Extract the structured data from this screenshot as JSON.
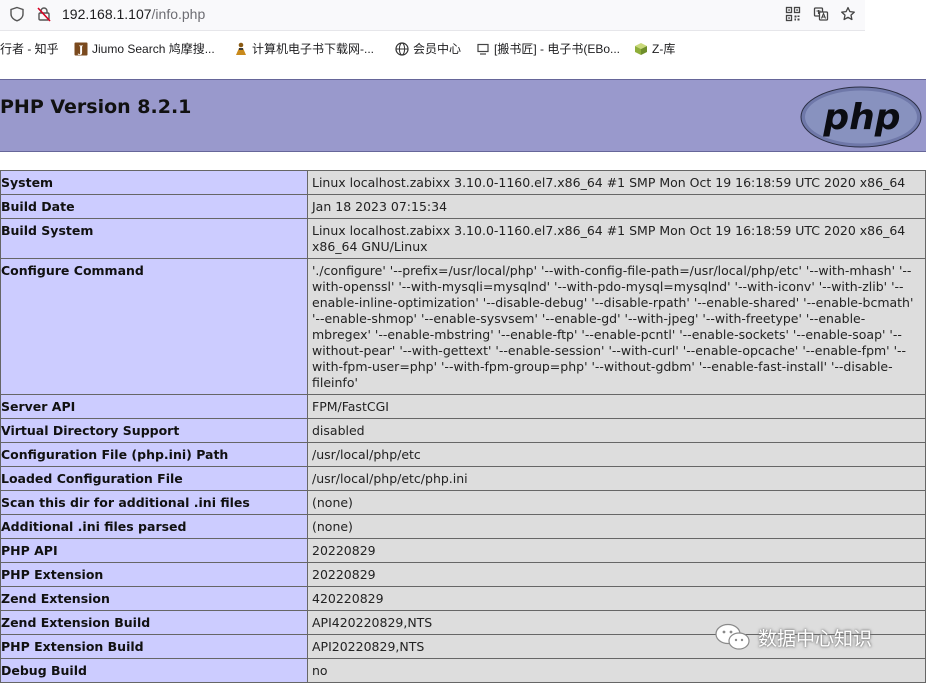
{
  "browser": {
    "url_host": "192.168.1.107",
    "url_path": "/info.php",
    "icons": [
      "shield-icon",
      "insecure-lock-icon",
      "qr-code-icon",
      "translate-icon",
      "star-icon"
    ]
  },
  "bookmarks": [
    {
      "label": "行者 - 知乎",
      "icon": "none"
    },
    {
      "label": "Jiumo Search 鸠摩搜...",
      "icon": "j-icon"
    },
    {
      "label": "计算机电子书下载网-...",
      "icon": "figure-icon"
    },
    {
      "label": "会员中心",
      "icon": "globe-icon"
    },
    {
      "label": "[搬书匠] - 电子书(EBo...",
      "icon": "monitor-icon"
    },
    {
      "label": "Z-库",
      "icon": "cube-icon"
    }
  ],
  "header": {
    "title": "PHP Version 8.2.1",
    "logo_text": "php",
    "colors": {
      "header_bg": "#9999cc",
      "key_bg": "#ccccff",
      "value_bg": "#dddddd"
    }
  },
  "rows": [
    {
      "key": "System",
      "value": "Linux localhost.zabixx 3.10.0-1160.el7.x86_64 #1 SMP Mon Oct 19 16:18:59 UTC 2020 x86_64"
    },
    {
      "key": "Build Date",
      "value": "Jan 18 2023 07:15:34"
    },
    {
      "key": "Build System",
      "value": "Linux localhost.zabixx 3.10.0-1160.el7.x86_64 #1 SMP Mon Oct 19 16:18:59 UTC 2020 x86_64 x86_64 GNU/Linux"
    },
    {
      "key": "Configure Command",
      "value": "'./configure' '--prefix=/usr/local/php' '--with-config-file-path=/usr/local/php/etc' '--with-mhash' '--with-openssl' '--with-mysqli=mysqlnd' '--with-pdo-mysql=mysqlnd' '--with-iconv' '--with-zlib' '--enable-inline-optimization' '--disable-debug' '--disable-rpath' '--enable-shared' '--enable-bcmath' '--enable-shmop' '--enable-sysvsem' '--enable-gd' '--with-jpeg' '--with-freetype' '--enable-mbregex' '--enable-mbstring' '--enable-ftp' '--enable-pcntl' '--enable-sockets' '--enable-soap' '--without-pear' '--with-gettext' '--enable-session' '--with-curl' '--enable-opcache' '--enable-fpm' '--with-fpm-user=php' '--with-fpm-group=php' '--without-gdbm' '--enable-fast-install' '--disable-fileinfo'"
    },
    {
      "key": "Server API",
      "value": "FPM/FastCGI"
    },
    {
      "key": "Virtual Directory Support",
      "value": "disabled"
    },
    {
      "key": "Configuration File (php.ini) Path",
      "value": "/usr/local/php/etc"
    },
    {
      "key": "Loaded Configuration File",
      "value": "/usr/local/php/etc/php.ini"
    },
    {
      "key": "Scan this dir for additional .ini files",
      "value": "(none)"
    },
    {
      "key": "Additional .ini files parsed",
      "value": "(none)"
    },
    {
      "key": "PHP API",
      "value": "20220829"
    },
    {
      "key": "PHP Extension",
      "value": "20220829"
    },
    {
      "key": "Zend Extension",
      "value": "420220829"
    },
    {
      "key": "Zend Extension Build",
      "value": "API420220829,NTS"
    },
    {
      "key": "PHP Extension Build",
      "value": "API20220829,NTS"
    },
    {
      "key": "Debug Build",
      "value": "no"
    }
  ],
  "watermark": {
    "text": "数据中心知识",
    "icon": "wechat-icon"
  }
}
